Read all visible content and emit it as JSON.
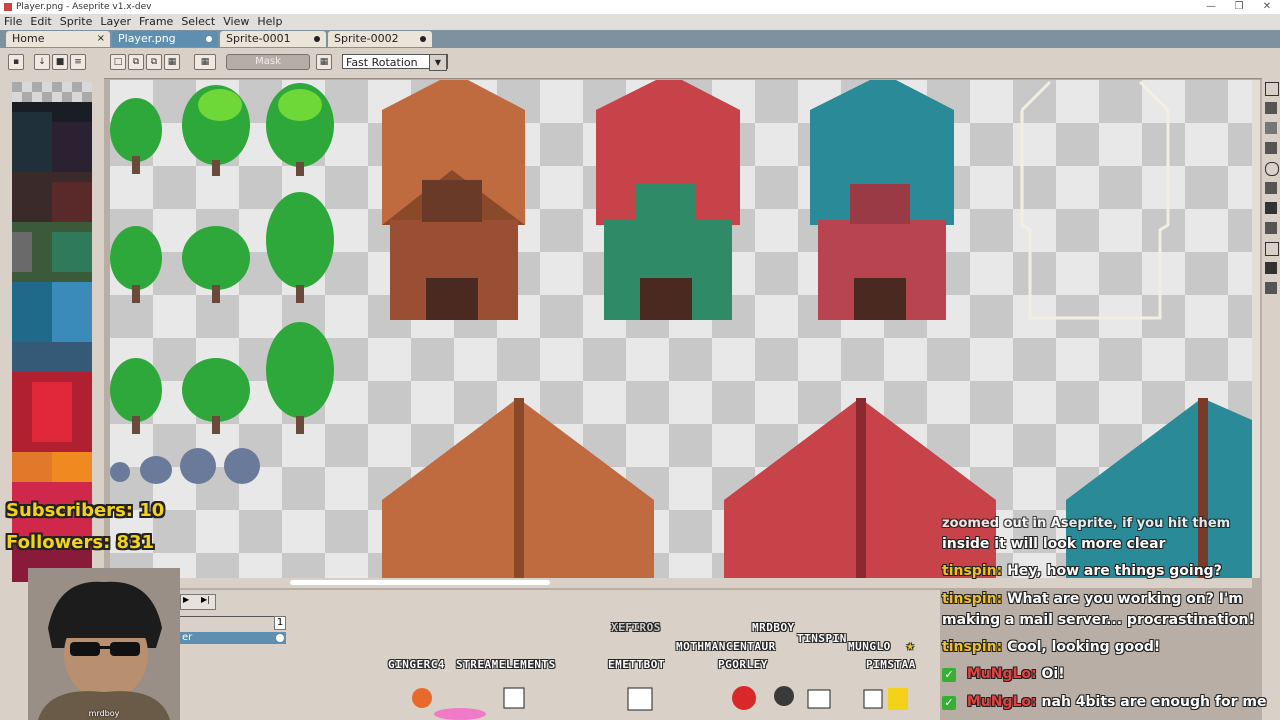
{
  "window": {
    "title": "Player.png - Aseprite v1.x-dev",
    "minimize": "—",
    "restore": "❐",
    "close": "✕"
  },
  "menu": [
    "File",
    "Edit",
    "Sprite",
    "Layer",
    "Frame",
    "Select",
    "View",
    "Help"
  ],
  "tabs": [
    {
      "label": "Home",
      "active": false,
      "close": "×"
    },
    {
      "label": "Player.png",
      "active": true
    },
    {
      "label": "Sprite-0001",
      "active": false
    },
    {
      "label": "Sprite-0002",
      "active": false
    }
  ],
  "toolbar": {
    "mask_label": "Mask",
    "rotation_value": "Fast Rotation",
    "rotation_arrow": "▼"
  },
  "timeline": {
    "frame_number": "1",
    "layer_label": "er"
  },
  "overlay": {
    "subscribers": "Subscribers: 10",
    "followers": "Followers: 831",
    "webcam_name": "mrdboy"
  },
  "chat": {
    "partial_line": "zoomed out in Aseprite, if you hit them",
    "lines": [
      {
        "user": "",
        "text": "inside it will look more clear"
      },
      {
        "user": "tinspin:",
        "text": "Hey, how are things going?"
      },
      {
        "user": "tinspin:",
        "text": "What are you working on? I'm"
      },
      {
        "user": "",
        "text": "making a mail server... procrastination!"
      },
      {
        "user": "tinspin:",
        "text": "Cool, looking good!"
      },
      {
        "user": "MuNgLo:",
        "text": "Oi!"
      },
      {
        "user": "MuNgLo:",
        "text": "nah 4bits are enough for me"
      }
    ],
    "check_glyph": "✓"
  },
  "viewers": [
    "XEFIROS",
    "MRDBOY",
    "MOTHMANCENTAUR",
    "TINSPIN",
    "MUNGLO",
    "GINGERC4",
    "STREAMELEMENTS",
    "EMETTBOT",
    "PGORLEY",
    "PIMSTAA"
  ],
  "viewer_star": "★",
  "colors": {
    "accent_tab": "#5f8fb0",
    "tab_bar": "#7d929e",
    "overlay_text": "#f5d21a"
  }
}
